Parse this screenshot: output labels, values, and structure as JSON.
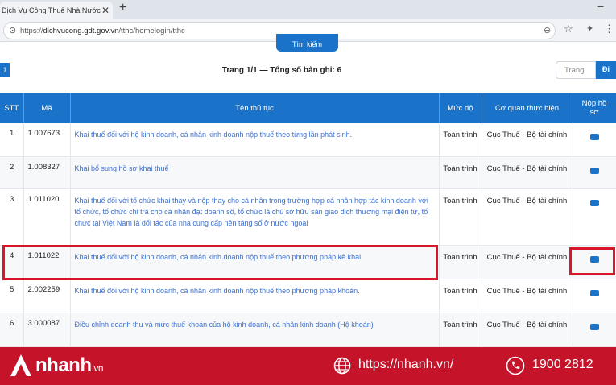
{
  "browser": {
    "tab_title": "Dịch Vụ Công Thuế Nhà Nước",
    "url_prefix": "https://",
    "url_domain": "dichvucong.gdt.gov.vn",
    "url_path": "/tthc/homelogin/tthc"
  },
  "toolbar": {
    "search_label": "Tìm kiếm",
    "page_button": "1",
    "paging_info": "Trang 1/1 — Tổng số bản ghi: 6",
    "page_placeholder": "Trang",
    "go_label": "Đi"
  },
  "table": {
    "headers": [
      "STT",
      "Mã",
      "Tên thủ tục",
      "Mức độ",
      "Cơ quan thực hiện",
      "Nộp hồ sơ"
    ],
    "rows": [
      {
        "stt": "1",
        "code": "1.007673",
        "name": "Khai thuế đối với hộ kinh doanh, cá nhân kinh doanh nộp thuế theo từng lần phát sinh.",
        "level": "Toàn trình",
        "agency": "Cục Thuế - Bộ tài chính"
      },
      {
        "stt": "2",
        "code": "1.008327",
        "name": "Khai bổ sung hồ sơ khai thuế",
        "level": "Toàn trình",
        "agency": "Cục Thuế - Bộ tài chính"
      },
      {
        "stt": "3",
        "code": "1.011020",
        "name": "Khai thuế đối với tổ chức khai thay và nộp thay cho cá nhân trong trường hợp cá nhân hợp tác kinh doanh với tổ chức, tổ chức chi trả cho cá nhân đạt doanh số, tổ chức là chủ sở hữu sàn giao dịch thương mại điện tử, tổ chức tại Việt Nam là đối tác của nhà cung cấp nền tảng số ở nước ngoài",
        "level": "Toàn trình",
        "agency": "Cục Thuế - Bộ tài chính"
      },
      {
        "stt": "4",
        "code": "1.011022",
        "name": "Khai thuế đối với hộ kinh doanh, cá nhân kinh doanh nộp thuế theo phương pháp kê khai",
        "level": "Toàn trình",
        "agency": "Cục Thuế - Bộ tài chính"
      },
      {
        "stt": "5",
        "code": "2.002259",
        "name": "Khai thuế đối với hộ kinh doanh, cá nhân kinh doanh nộp thuế theo phương pháp khoán.",
        "level": "Toàn trình",
        "agency": "Cục Thuế - Bộ tài chính"
      },
      {
        "stt": "6",
        "code": "3.000087",
        "name": "Điều chỉnh doanh thu và mức thuế khoán của hộ kinh doanh, cá nhân kinh doanh (Hộ khoán)",
        "level": "Toàn trình",
        "agency": "Cục Thuế - Bộ tài chính"
      }
    ]
  },
  "footer": {
    "brand": "nhanh",
    "brand_suffix": ".vn",
    "website": "https://nhanh.vn/",
    "phone": "1900 2812"
  },
  "colors": {
    "primary_blue": "#1a73c8",
    "highlight_red": "#d9162a",
    "footer_red": "#c5132a",
    "link_blue": "#3a6fd0"
  },
  "icons": [
    "lock-icon",
    "star-icon",
    "extensions-icon",
    "menu-icon",
    "file-upload-icon",
    "globe-icon",
    "phone-icon"
  ]
}
